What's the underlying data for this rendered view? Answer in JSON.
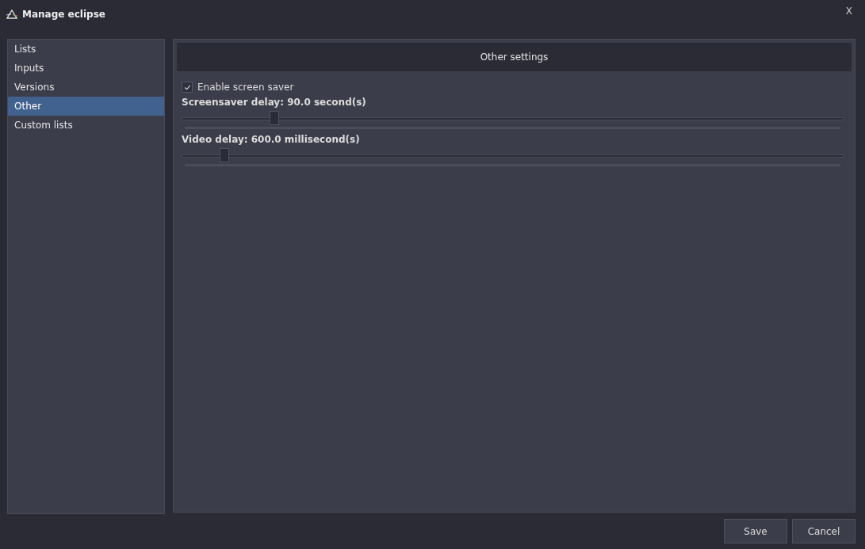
{
  "window": {
    "title": "Manage eclipse",
    "close": "X"
  },
  "sidebar": {
    "items": [
      {
        "label": "Lists",
        "selected": false
      },
      {
        "label": "Inputs",
        "selected": false
      },
      {
        "label": "Versions",
        "selected": false
      },
      {
        "label": "Other",
        "selected": true
      },
      {
        "label": "Custom lists",
        "selected": false
      }
    ]
  },
  "panel": {
    "header": "Other settings",
    "checkbox": {
      "label": "Enable screen saver",
      "checked": true
    },
    "sliders": [
      {
        "label": "Screensaver delay:",
        "value": "90.0",
        "unit": "second(s)",
        "level": 0.14
      },
      {
        "label": "Video delay:",
        "value": "600.0",
        "unit": "millisecond(s)",
        "level": 0.065
      }
    ]
  },
  "buttons": [
    "Save",
    "Cancel"
  ]
}
